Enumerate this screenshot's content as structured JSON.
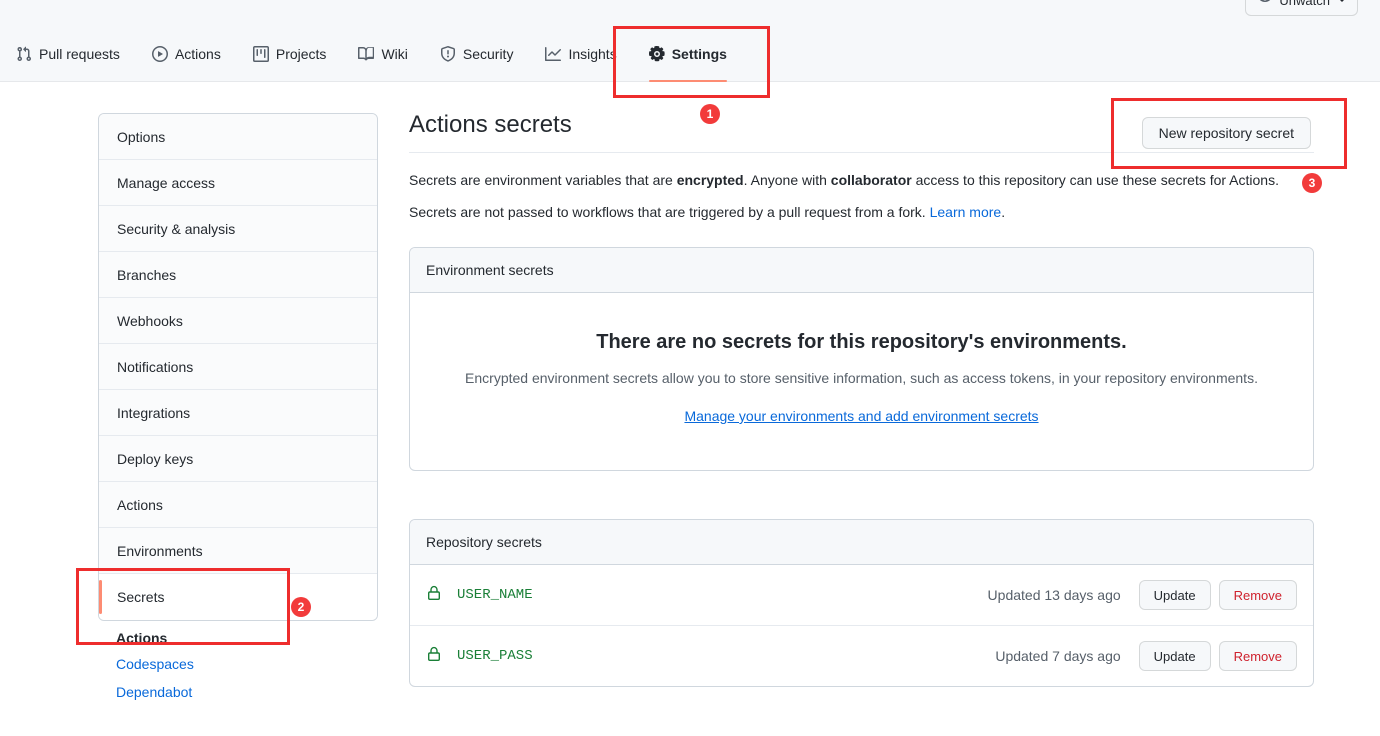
{
  "header": {
    "watch_label": "Unwatch",
    "watch_icon": "eye-icon"
  },
  "repo_nav": {
    "items": [
      {
        "label": "Pull requests",
        "icon": "git-pull-request-icon",
        "active": false
      },
      {
        "label": "Actions",
        "icon": "play-circle-icon",
        "active": false
      },
      {
        "label": "Projects",
        "icon": "project-board-icon",
        "active": false
      },
      {
        "label": "Wiki",
        "icon": "book-icon",
        "active": false
      },
      {
        "label": "Security",
        "icon": "shield-icon",
        "active": false
      },
      {
        "label": "Insights",
        "icon": "graph-icon",
        "active": false
      },
      {
        "label": "Settings",
        "icon": "gear-icon",
        "active": true
      }
    ]
  },
  "sidebar": {
    "items": [
      {
        "label": "Options",
        "selected": false
      },
      {
        "label": "Manage access",
        "selected": false
      },
      {
        "label": "Security & analysis",
        "selected": false
      },
      {
        "label": "Branches",
        "selected": false
      },
      {
        "label": "Webhooks",
        "selected": false
      },
      {
        "label": "Notifications",
        "selected": false
      },
      {
        "label": "Integrations",
        "selected": false
      },
      {
        "label": "Deploy keys",
        "selected": false
      },
      {
        "label": "Actions",
        "selected": false
      },
      {
        "label": "Environments",
        "selected": false
      },
      {
        "label": "Secrets",
        "selected": true
      }
    ],
    "section": {
      "heading": "Actions",
      "links": [
        "Codespaces",
        "Dependabot"
      ]
    }
  },
  "main": {
    "title": "Actions secrets",
    "new_secret_button": "New repository secret",
    "description_1": {
      "part1": "Secrets are environment variables that are ",
      "bold1": "encrypted",
      "part2": ". Anyone with ",
      "bold2": "collaborator",
      "part3": " access to this repository can use these secrets for Actions."
    },
    "description_2": {
      "text": "Secrets are not passed to workflows that are triggered by a pull request from a fork. ",
      "link": "Learn more",
      "suffix": "."
    },
    "environment_panel": {
      "header": "Environment secrets",
      "empty_title": "There are no secrets for this repository's environments.",
      "empty_subtitle": "Encrypted environment secrets allow you to store sensitive information, such as access tokens, in your repository environments.",
      "empty_link": "Manage your environments and add environment secrets"
    },
    "repository_panel": {
      "header": "Repository secrets",
      "rows": [
        {
          "icon": "lock-icon",
          "name": "USER_NAME",
          "updated": "Updated 13 days ago",
          "update_label": "Update",
          "remove_label": "Remove"
        },
        {
          "icon": "lock-icon",
          "name": "USER_PASS",
          "updated": "Updated 7 days ago",
          "update_label": "Update",
          "remove_label": "Remove"
        }
      ]
    }
  },
  "annotations": {
    "badges": [
      {
        "number": "1"
      },
      {
        "number": "2"
      },
      {
        "number": "3"
      }
    ],
    "accent_color": "#ee2d2d"
  }
}
